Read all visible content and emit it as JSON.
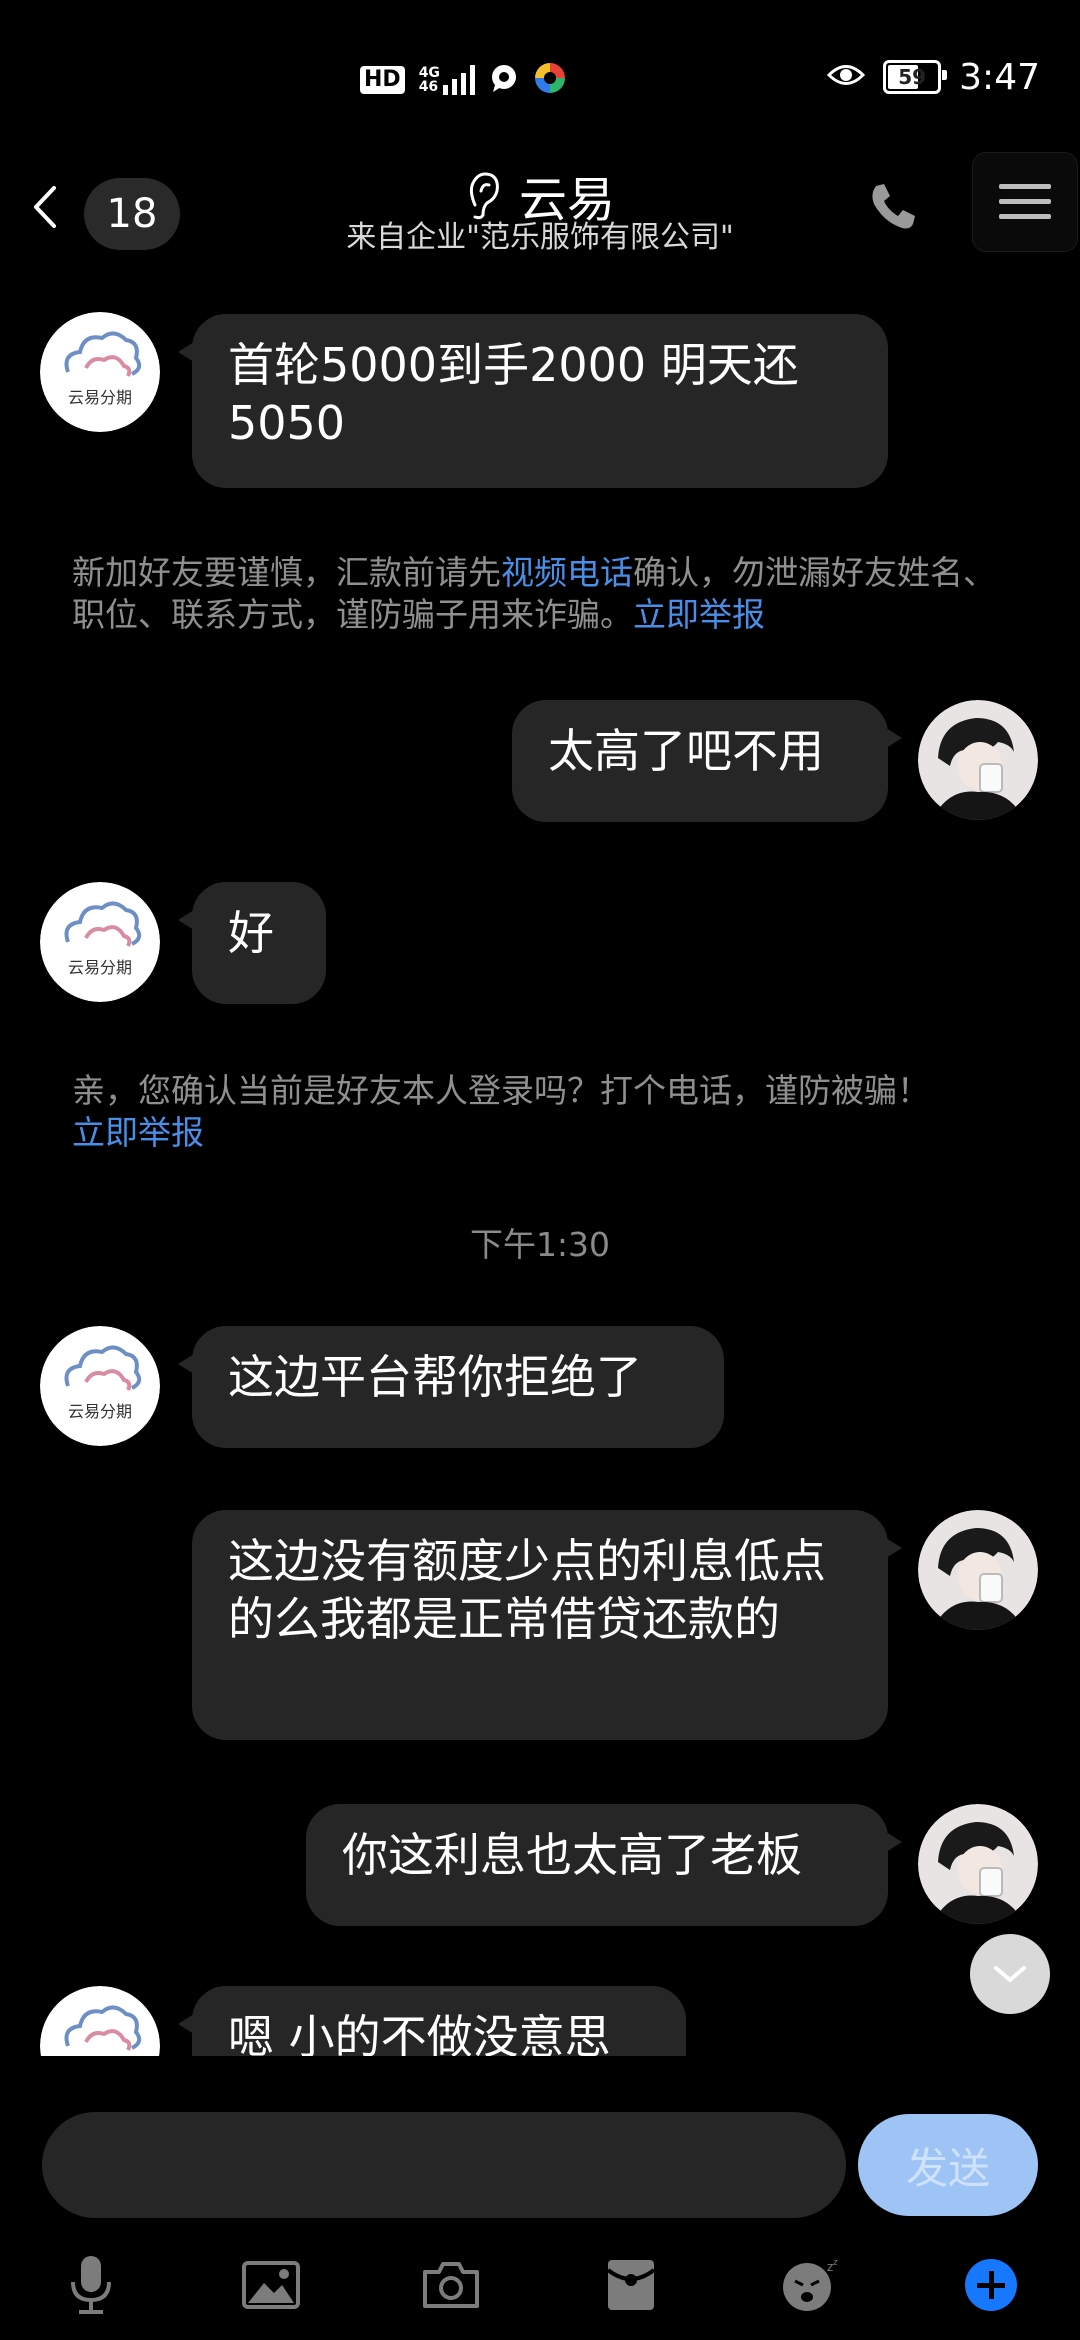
{
  "status_bar": {
    "hd": "HD",
    "network_top": "4G",
    "network_bottom": "46",
    "battery": "59",
    "time": "3:47"
  },
  "header": {
    "unread_count": "18",
    "title": "云易",
    "subtitle": "来自企业\"范乐服饰有限公司\""
  },
  "contact": {
    "avatar_text": "云易分期",
    "accent_colors": [
      "#6d8fc4",
      "#d98ca0"
    ]
  },
  "messages": [
    {
      "side": "left",
      "text": "首轮5000到手2000 明天还5050"
    },
    {
      "side": "right",
      "text": "太高了吧不用"
    },
    {
      "side": "left",
      "text": "好"
    },
    {
      "side": "left",
      "text": "这边平台帮你拒绝了"
    },
    {
      "side": "right",
      "text": "这边没有额度少点的利息低点的么我都是正常借贷还款的"
    },
    {
      "side": "right",
      "text": "你这利息也太高了老板"
    },
    {
      "side": "left",
      "text": "嗯 小的不做没意思"
    }
  ],
  "notices": [
    {
      "part1": "新加好友要谨慎，汇款前请先",
      "link1": "视频电话",
      "part2": "确认，勿泄漏好友姓名、职位、联系方式，谨防骗子用来诈骗。",
      "link2": "立即举报"
    },
    {
      "part1": "亲，您确认当前是好友本人登录吗？打个电话，谨防被骗！",
      "link": "立即举报"
    }
  ],
  "timestamp": "下午1:30",
  "input": {
    "value": "",
    "send_label": "发送"
  },
  "colors": {
    "background": "#000000",
    "bubble": "#262626",
    "link": "#4a8fe7",
    "send_button": "#9ec3f5",
    "plus_button": "#1677ff"
  },
  "toolbar_icons": [
    "microphone-icon",
    "image-icon",
    "camera-icon",
    "red-packet-icon",
    "sticker-icon",
    "plus-icon"
  ]
}
